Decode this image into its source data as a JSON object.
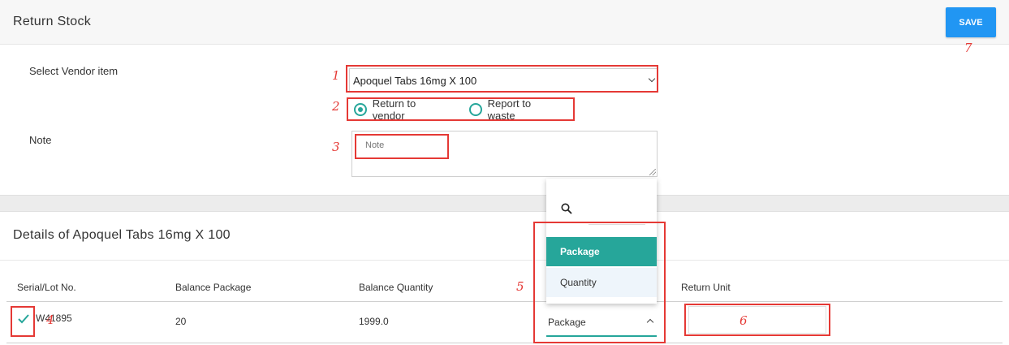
{
  "header": {
    "title": "Return Stock",
    "save_label": "SAVE"
  },
  "form": {
    "vendor_label": "Select Vendor item",
    "vendor_value": "Apoquel Tabs 16mg X 100",
    "radio_options": [
      {
        "label": "Return to vendor",
        "checked": true
      },
      {
        "label": "Report to waste",
        "checked": false
      }
    ],
    "note_label": "Note",
    "note_placeholder": "Note"
  },
  "details": {
    "title": "Details of Apoquel Tabs 16mg X 100",
    "columns": [
      "Serial/Lot No.",
      "Balance Package",
      "Balance Quantity",
      "Return Unit"
    ],
    "row": {
      "serial": "W41895",
      "balance_package": "20",
      "balance_quantity": "1999.0",
      "unit": "Package"
    }
  },
  "unit_dropdown": {
    "options": [
      "Package",
      "Quantity"
    ],
    "selected": "Package"
  },
  "annotations": [
    "1",
    "2",
    "3",
    "4",
    "5",
    "6",
    "7"
  ],
  "colors": {
    "accent": "#26a69a",
    "primary": "#2196f3",
    "annotation": "#e53935"
  }
}
